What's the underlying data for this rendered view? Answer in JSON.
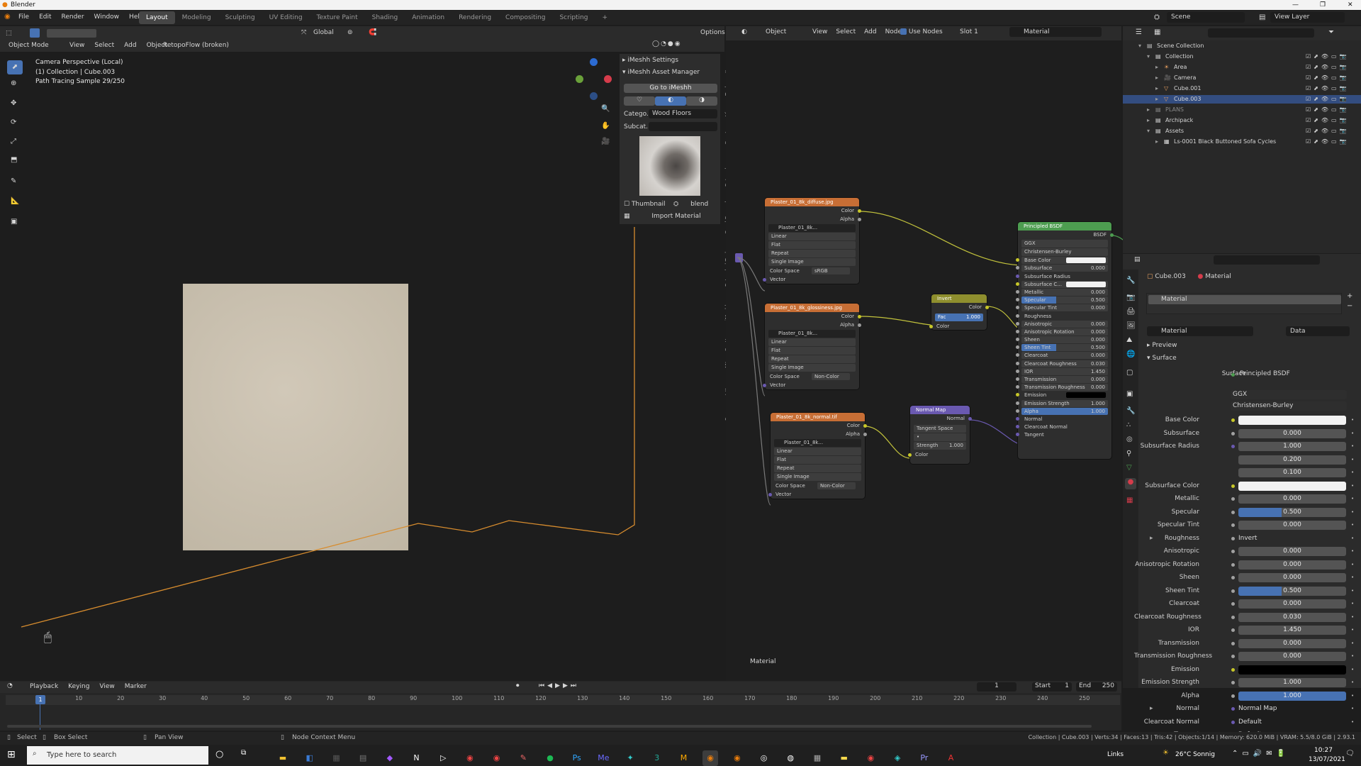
{
  "window": {
    "title": "Blender"
  },
  "menu": [
    "File",
    "Edit",
    "Render",
    "Window",
    "Help"
  ],
  "workspaces": [
    "Layout",
    "Modeling",
    "Sculpting",
    "UV Editing",
    "Texture Paint",
    "Shading",
    "Animation",
    "Rendering",
    "Compositing",
    "Scripting",
    "+"
  ],
  "scene": {
    "name": "Scene",
    "view_layer": "View Layer"
  },
  "viewport": {
    "mode": "Object Mode",
    "menus": [
      "View",
      "Select",
      "Add",
      "Object"
    ],
    "addon": "RetopoFlow (broken)",
    "orientation": "Global",
    "options": "Options",
    "info_lines": [
      "Camera Perspective (Local)",
      "(1) Collection | Cube.003",
      "Path Tracing Sample 29/250"
    ]
  },
  "imeshh": {
    "settings": "iMeshh Settings",
    "asset_manager": "iMeshh Asset Manager",
    "goto": "Go to iMeshh",
    "category_label": "Catego...",
    "category_value": "Wood Floors",
    "subcat_label": "Subcat...",
    "thumb_label": "Thumbnail",
    "blend_label": "blend",
    "import": "Import Material",
    "tabs": [
      "Item",
      "Tool",
      "View",
      "Create",
      "Retopology",
      "Quad Remesh",
      "Extended Tools",
      "iMeshh",
      "Scatter",
      "AN",
      "Screencast Keys"
    ]
  },
  "node_editor": {
    "header": {
      "type": "Object",
      "menus": [
        "View",
        "Select",
        "Add",
        "Node"
      ],
      "use_nodes": "Use Nodes",
      "slot": "Slot 1",
      "material": "Material"
    },
    "footer_label": "Material",
    "nodes": {
      "tex1": {
        "title": "Plaster_01_8k_diffuse.jpg",
        "img": "Plaster_01_8k...",
        "outs": [
          "Color",
          "Alpha"
        ],
        "fields": [
          "Linear",
          "Flat",
          "Repeat",
          "Single Image"
        ],
        "cs_label": "Color Space",
        "cs_value": "sRGB",
        "vec": "Vector"
      },
      "tex2": {
        "title": "Plaster_01_8k_glossiness.jpg",
        "img": "Plaster_01_8k...",
        "outs": [
          "Color",
          "Alpha"
        ],
        "fields": [
          "Linear",
          "Flat",
          "Repeat",
          "Single Image"
        ],
        "cs_label": "Color Space",
        "cs_value": "Non-Color",
        "vec": "Vector"
      },
      "tex3": {
        "title": "Plaster_01_8k_normal.tif",
        "img": "Plaster_01_8k...",
        "outs": [
          "Color",
          "Alpha"
        ],
        "fields": [
          "Linear",
          "Flat",
          "Repeat",
          "Single Image"
        ],
        "cs_label": "Color Space",
        "cs_value": "Non-Color",
        "vec": "Vector"
      },
      "invert": {
        "title": "Invert",
        "out": "Color",
        "fac_label": "Fac",
        "fac_value": "1.000",
        "in": "Color"
      },
      "normal": {
        "title": "Normal Map",
        "out": "Normal",
        "space": "Tangent Space",
        "str_label": "Strength",
        "str_value": "1.000",
        "in": "Color"
      },
      "bsdf": {
        "title": "Principled BSDF",
        "out": "BSDF",
        "dist": "GGX",
        "sss": "Christensen-Burley",
        "rows": [
          [
            "Base Color",
            ""
          ],
          [
            "Subsurface",
            "0.000"
          ],
          [
            "Subsurface Radius",
            ""
          ],
          [
            "Subsurface C...",
            ""
          ],
          [
            "Metallic",
            "0.000"
          ],
          [
            "Specular",
            "0.500"
          ],
          [
            "Specular Tint",
            "0.000"
          ],
          [
            "Roughness",
            ""
          ],
          [
            "Anisotropic",
            "0.000"
          ],
          [
            "Anisotropic Rotation",
            "0.000"
          ],
          [
            "Sheen",
            "0.000"
          ],
          [
            "Sheen Tint",
            "0.500"
          ],
          [
            "Clearcoat",
            "0.000"
          ],
          [
            "Clearcoat Roughness",
            "0.030"
          ],
          [
            "IOR",
            "1.450"
          ],
          [
            "Transmission",
            "0.000"
          ],
          [
            "Transmission Roughness",
            "0.000"
          ],
          [
            "Emission",
            ""
          ],
          [
            "Emission Strength",
            "1.000"
          ],
          [
            "Alpha",
            "1.000"
          ],
          [
            "Normal",
            ""
          ],
          [
            "Clearcoat Normal",
            ""
          ],
          [
            "Tangent",
            ""
          ]
        ]
      }
    }
  },
  "outliner": {
    "items": [
      {
        "label": "Scene Collection",
        "indent": 0
      },
      {
        "label": "Collection",
        "indent": 1
      },
      {
        "label": "Area",
        "indent": 2
      },
      {
        "label": "Camera",
        "indent": 2
      },
      {
        "label": "Cube.001",
        "indent": 2
      },
      {
        "label": "Cube.003",
        "indent": 2,
        "selected": true
      },
      {
        "label": "PLANS",
        "indent": 1
      },
      {
        "label": "Archipack",
        "indent": 1
      },
      {
        "label": "Assets",
        "indent": 1
      },
      {
        "label": "Ls-0001 Black Buttoned Sofa Cycles",
        "indent": 2
      }
    ]
  },
  "properties": {
    "object": "Cube.003",
    "material": "Material",
    "slot_item": "Material",
    "data_label": "Data",
    "preview": "Preview",
    "surface_section": "Surface",
    "surface_label": "Surface",
    "surface_value": "Principled BSDF",
    "dist": "GGX",
    "sss": "Christensen-Burley",
    "rows": [
      {
        "label": "Base Color",
        "value": "",
        "type": "color-white"
      },
      {
        "label": "Subsurface",
        "value": "0.000"
      },
      {
        "label": "Subsurface Radius",
        "value": "1.000"
      },
      {
        "label": "",
        "value": "0.200"
      },
      {
        "label": "",
        "value": "0.100"
      },
      {
        "label": "Subsurface Color",
        "value": "",
        "type": "color-white"
      },
      {
        "label": "Metallic",
        "value": "0.000"
      },
      {
        "label": "Specular",
        "value": "0.500",
        "type": "blue"
      },
      {
        "label": "Specular Tint",
        "value": "0.000"
      },
      {
        "label": "Roughness",
        "value": "Invert",
        "type": "text"
      },
      {
        "label": "Anisotropic",
        "value": "0.000"
      },
      {
        "label": "Anisotropic Rotation",
        "value": "0.000"
      },
      {
        "label": "Sheen",
        "value": "0.000"
      },
      {
        "label": "Sheen Tint",
        "value": "0.500",
        "type": "blue"
      },
      {
        "label": "Clearcoat",
        "value": "0.000"
      },
      {
        "label": "Clearcoat Roughness",
        "value": "0.030"
      },
      {
        "label": "IOR",
        "value": "1.450"
      },
      {
        "label": "Transmission",
        "value": "0.000"
      },
      {
        "label": "Transmission Roughness",
        "value": "0.000"
      },
      {
        "label": "Emission",
        "value": "",
        "type": "color-black"
      },
      {
        "label": "Emission Strength",
        "value": "1.000"
      },
      {
        "label": "Alpha",
        "value": "1.000",
        "type": "blue"
      },
      {
        "label": "Normal",
        "value": "Normal Map",
        "type": "text"
      },
      {
        "label": "Clearcoat Normal",
        "value": "Default",
        "type": "text"
      },
      {
        "label": "Tangent",
        "value": "Default",
        "type": "text"
      }
    ]
  },
  "timeline": {
    "menus": [
      "Playback",
      "Keying",
      "View",
      "Marker"
    ],
    "frame": "1",
    "start_label": "Start",
    "start": "1",
    "end_label": "End",
    "end": "250",
    "ticks": [
      "1",
      "10",
      "20",
      "30",
      "40",
      "50",
      "60",
      "70",
      "80",
      "90",
      "100",
      "110",
      "120",
      "130",
      "140",
      "150",
      "160",
      "170",
      "180",
      "190",
      "200",
      "210",
      "220",
      "230",
      "240",
      "250"
    ]
  },
  "statusbar": {
    "select": "Select",
    "box_select": "Box Select",
    "pan": "Pan View",
    "context": "Node Context Menu",
    "stats": "Collection | Cube.003 | Verts:34 | Faces:13 | Tris:42 | Objects:1/14 | Memory: 620.0 MiB | VRAM: 5.5/8.0 GiB | 2.93.1"
  },
  "taskbar": {
    "search_placeholder": "Type here to search",
    "links": "Links",
    "weather": "26°C Sonnig",
    "time": "10:27",
    "date": "13/07/2021"
  },
  "colors": {
    "accent": "#4772b3",
    "selection": "#334d80",
    "node_image": "#c76e35",
    "node_invert": "#8f8f2e",
    "node_normal": "#6a59b0",
    "node_bsdf": "#4d9d50",
    "wire": "#d78c2e"
  }
}
